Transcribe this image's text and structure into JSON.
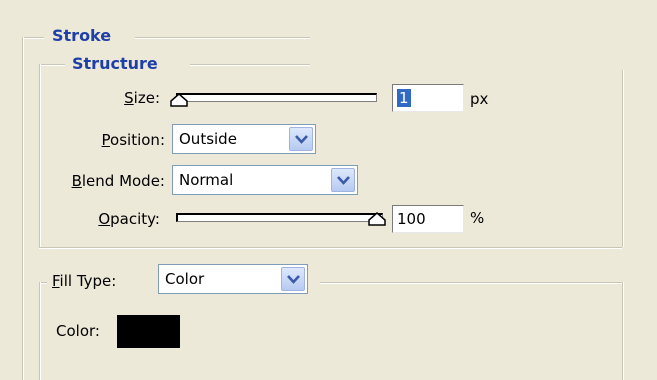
{
  "stroke": {
    "title": "Stroke"
  },
  "structure": {
    "title": "Structure",
    "size": {
      "label_mnemonic": "S",
      "label_rest": "ize:",
      "value": "1",
      "unit": "px",
      "slider_fraction": 0.0
    },
    "position": {
      "label_mnemonic": "P",
      "label_rest": "osition:",
      "selected": "Outside"
    },
    "blend_mode": {
      "label_mnemonic": "B",
      "label_rest": "lend Mode:",
      "selected": "Normal"
    },
    "opacity": {
      "label_mnemonic": "O",
      "label_rest": "pacity:",
      "value": "100",
      "unit": "%",
      "slider_fraction": 1.0
    }
  },
  "fill": {
    "type_label_mnemonic": "F",
    "type_label_rest": "ill Type:",
    "type_selected": "Color",
    "color_label": "Color:",
    "color_value": "#000000"
  },
  "icons": {
    "dropdown": "chevron-down-icon",
    "slider_thumb": "slider-thumb-icon"
  }
}
